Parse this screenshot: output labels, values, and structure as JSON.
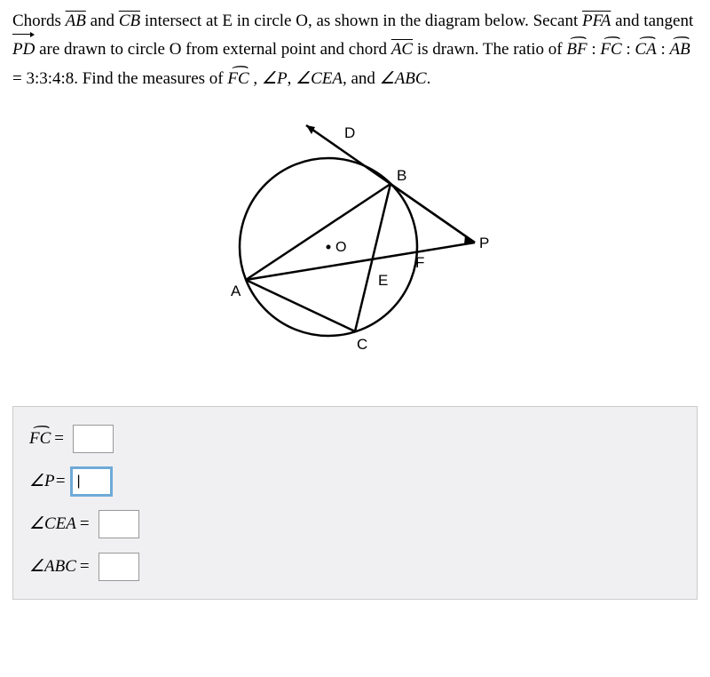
{
  "problem": {
    "part1_prefix": "Chords ",
    "seg_AB": "AB",
    "part1_and": " and ",
    "seg_CB": "CB",
    "part1_mid": " intersect at E in circle O, as shown in the diagram below. Secant ",
    "seg_PFA": "PFA",
    "part2_and": " and tangent ",
    "ray_PD": "PD",
    "part2_mid": " are drawn to circle O from external point and chord ",
    "seg_AC": "AC",
    "part2_end": " is drawn. The ratio of ",
    "arc_BF": "BF",
    "colon1": " : ",
    "arc_FC": "FC",
    "colon2": " : ",
    "arc_CA": "CA",
    "colon3": " : ",
    "arc_AB": "AB",
    "ratio_eq": " = 3:3:4:8. Find the measures of ",
    "find_FC": "FC",
    "comma1": " , ",
    "angle_P": "∠P",
    "comma2": ", ",
    "angle_CEA": "∠CEA",
    "comma3": ", and ",
    "angle_ABC": "∠ABC",
    "period": "."
  },
  "diagram": {
    "labels": {
      "D": "D",
      "B": "B",
      "P": "P",
      "F": "F",
      "E": "E",
      "O": "O",
      "A": "A",
      "C": "C"
    }
  },
  "answers": {
    "FC": {
      "label": "FC",
      "value": ""
    },
    "P": {
      "label": "∠P=",
      "value": "|"
    },
    "CEA": {
      "label": "∠CEA",
      "value": ""
    },
    "ABC": {
      "label": "∠ABC",
      "value": ""
    }
  }
}
